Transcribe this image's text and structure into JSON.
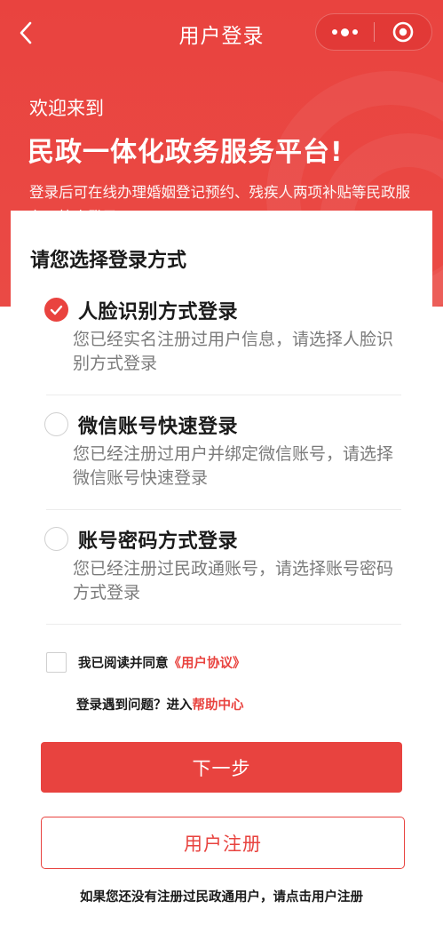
{
  "nav": {
    "title": "用户登录"
  },
  "hero": {
    "welcome": "欢迎来到",
    "platform_name": "民政一体化政务服务平台!",
    "description": "登录后可在线办理婚姻登记预约、残疾人两项补贴等民政服务，快来登录吧!"
  },
  "login": {
    "section_title": "请您选择登录方式",
    "options": [
      {
        "title": "人脸识别方式登录",
        "desc": "您已经实名注册过用户信息，请选择人脸识别方式登录",
        "checked": true
      },
      {
        "title": "微信账号快速登录",
        "desc": "您已经注册过用户并绑定微信账号，请选择微信账号快速登录",
        "checked": false
      },
      {
        "title": "账号密码方式登录",
        "desc": "您已经注册过民政通账号，请选择账号密码方式登录",
        "checked": false
      }
    ],
    "agree_text": "我已阅读并同意",
    "agreement_link": "《用户协议》",
    "help_text": "登录遇到问题？进入",
    "help_link": "帮助中心",
    "next_label": "下一步",
    "register_label": "用户注册",
    "footer_note": "如果您还没有注册过民政通用户，请点击用户注册"
  },
  "colors": {
    "primary": "#e9433f",
    "text": "#1a1a1a",
    "muted": "#7b7b7b"
  }
}
